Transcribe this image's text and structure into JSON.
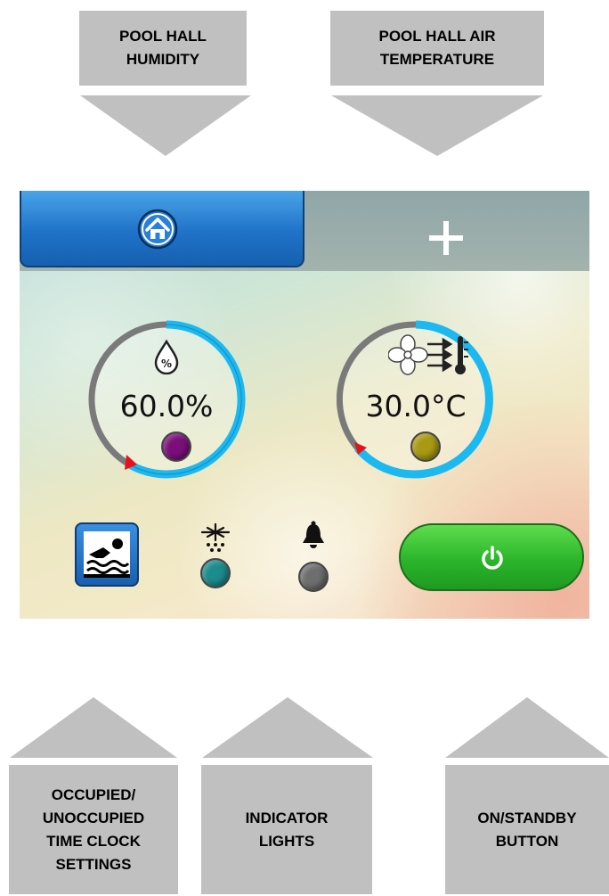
{
  "callouts": {
    "humidity": "POOL HALL\nHUMIDITY",
    "air_temperature": "POOL HALL AIR\nTEMPERATURE",
    "time_clock": "OCCUPIED/\nUNOCCUPIED\nTIME CLOCK\nSETTINGS",
    "indicator_lights": "INDICATOR\nLIGHTS",
    "on_standby": "ON/STANDBY\nBUTTON"
  },
  "screen": {
    "tabs": [
      {
        "icon": "home-icon",
        "selected": true
      },
      {
        "icon": "plus-icon",
        "selected": false
      }
    ],
    "humidity": {
      "value": "60.0%",
      "icon": "humidity-drop-icon",
      "led_color": "#7a0f7a"
    },
    "temperature": {
      "value": "30.0°C",
      "icon": "fan-thermometer-icon",
      "led_color": "#a89a12"
    },
    "indicators": [
      {
        "icon": "snowflake-icon",
        "led_color": "#1d8c8c"
      },
      {
        "icon": "bell-icon",
        "led_color": "#6e6e6e"
      }
    ],
    "buttons": {
      "occupied_icon": "swimmer-icon",
      "power_icon": "power-icon"
    },
    "colors": {
      "dial_active": "#1cb8f0",
      "dial_inactive": "#7a7a7a",
      "setpoint_marker": "#e8101a"
    }
  }
}
